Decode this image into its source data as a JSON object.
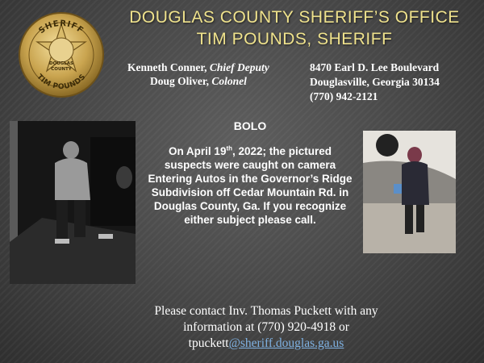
{
  "header": {
    "title_line1": "DOUGLAS COUNTY SHERIFF’S OFFICE",
    "title_line2": "TIM POUNDS, SHERIFF"
  },
  "badge": {
    "top_text": "SHERIFF",
    "center_top": "DOUGLAS",
    "center_bottom": "COUNTY",
    "bottom_text": "TIM POUNDS"
  },
  "staff": {
    "person1_name": "Kenneth Conner, ",
    "person1_role": "Chief Deputy",
    "person2_name": "Doug Oliver, ",
    "person2_role": "Colonel"
  },
  "address": {
    "street": "8470 Earl D. Lee Boulevard",
    "city_state_zip": "Douglasville, Georgia 30134",
    "phone": "(770) 942-2121"
  },
  "bolo": {
    "heading": "BOLO",
    "text_before_sup": "On April 19",
    "text_sup": "th",
    "text_after_sup": ", 2022; the pictured suspects were caught on camera Entering Autos in the Governor’s Ridge Subdivision off Cedar Mountain Rd. in Douglas County, Ga. If you recognize either subject please call."
  },
  "contact": {
    "line1": "Please contact Inv. Thomas Puckett with any",
    "line2": "information at (770) 920-4918 or",
    "email_user": "tpuckett",
    "email_domain": "@sheriff.douglas.ga.us"
  }
}
